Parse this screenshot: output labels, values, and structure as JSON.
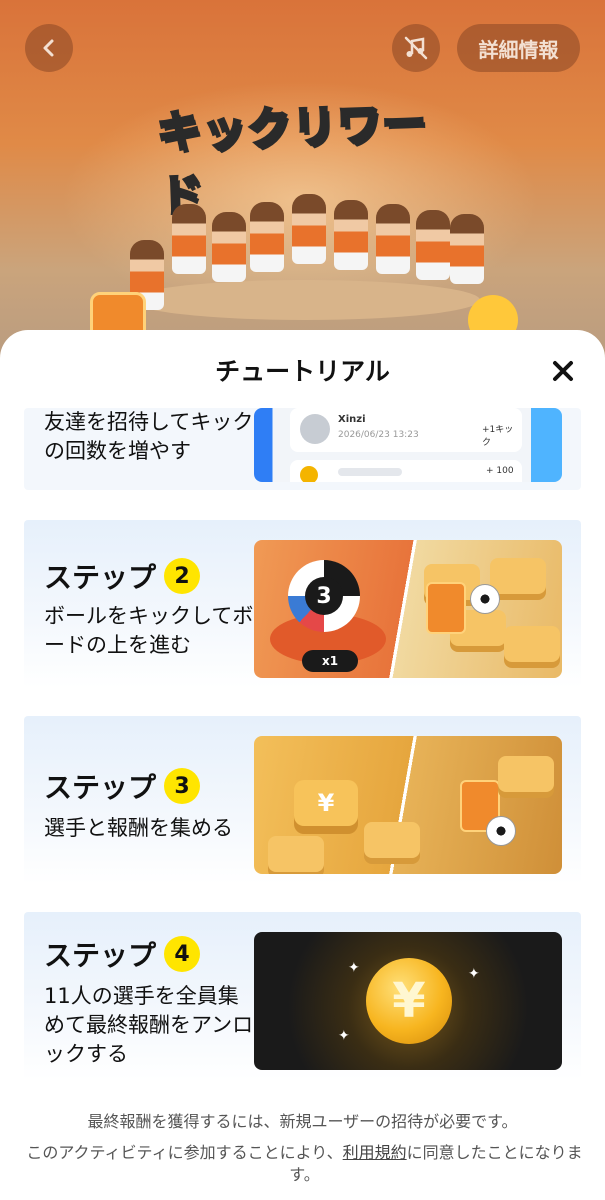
{
  "header": {
    "details_label": "詳細情報",
    "game_title": "キックリワード",
    "icons": {
      "back": "chevron-left-icon",
      "music": "music-muted-icon"
    }
  },
  "sheet": {
    "title": "チュートリアル",
    "close_icon": "close-icon"
  },
  "steps": [
    {
      "description": "友達を招待してキックの回数を増やす",
      "preview": {
        "name": "Xinzi",
        "date": "2026/06/23 13:23",
        "kick": "+1キック",
        "amount": "+ 100"
      }
    },
    {
      "heading": "ステップ",
      "number": "2",
      "description": "ボールをキックしてボードの上を進む",
      "ball_number": "3",
      "multiplier": "x1"
    },
    {
      "heading": "ステップ",
      "number": "3",
      "description": "選手と報酬を集める"
    },
    {
      "heading": "ステップ",
      "number": "4",
      "description": "11人の選手を全員集めて最終報酬をアンロックする"
    }
  ],
  "footer": {
    "note": "最終報酬を獲得するには、新規ユーザーの招待が必要です。",
    "terms_prefix": "このアクティビティに参加することにより、",
    "terms_link": "利用規約",
    "terms_suffix": "に同意したことになります。"
  },
  "colors": {
    "accent_yellow": "#ffe500",
    "card_bg": "#e6f0fb",
    "header_orange": "#d9733a"
  }
}
